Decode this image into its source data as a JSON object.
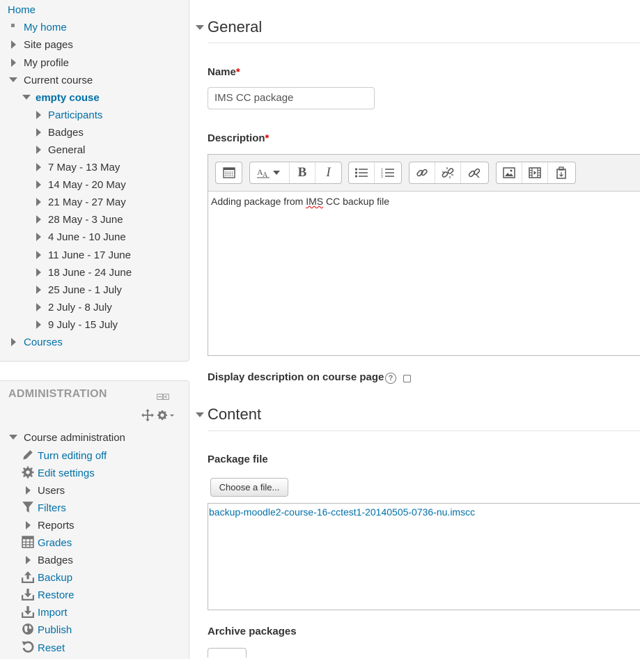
{
  "navigation": {
    "home": "Home",
    "my_home": "My home",
    "site_pages": "Site pages",
    "my_profile": "My profile",
    "current_course": "Current course",
    "course_name": "empty couse",
    "participants": "Participants",
    "badges": "Badges",
    "general": "General",
    "weeks": [
      "7 May - 13 May",
      "14 May - 20 May",
      "21 May - 27 May",
      "28 May - 3 June",
      "4 June - 10 June",
      "11 June - 17 June",
      "18 June - 24 June",
      "25 June - 1 July",
      "2 July - 8 July",
      "9 July - 15 July"
    ],
    "courses": "Courses"
  },
  "administration": {
    "title": "ADMINISTRATION",
    "course_administration": "Course administration",
    "items": [
      {
        "label": "Turn editing off",
        "icon": "pencil-icon",
        "link": true
      },
      {
        "label": "Edit settings",
        "icon": "gear-icon",
        "link": true
      },
      {
        "label": "Users",
        "icon": "expand-arrow-icon",
        "link": false
      },
      {
        "label": "Filters",
        "icon": "filter-icon",
        "link": true
      },
      {
        "label": "Reports",
        "icon": "expand-arrow-icon",
        "link": false
      },
      {
        "label": "Grades",
        "icon": "grades-table-icon",
        "link": true
      },
      {
        "label": "Badges",
        "icon": "expand-arrow-icon",
        "link": false
      },
      {
        "label": "Backup",
        "icon": "upload-icon",
        "link": true
      },
      {
        "label": "Restore",
        "icon": "download-icon",
        "link": true
      },
      {
        "label": "Import",
        "icon": "download-icon",
        "link": true
      },
      {
        "label": "Publish",
        "icon": "globe-icon",
        "link": true
      },
      {
        "label": "Reset",
        "icon": "reset-icon",
        "link": true
      }
    ]
  },
  "form": {
    "general_header": "General",
    "name_label": "Name",
    "required_mark": "*",
    "name_value": "IMS CC package",
    "description_label": "Description",
    "description_prefix": "Adding package from ",
    "description_flagged": "IMS",
    "description_suffix": " CC backup file",
    "display_description_label": "Display description on course page",
    "help_symbol": "?",
    "content_header": "Content",
    "package_file_label": "Package file",
    "choose_file_button": "Choose a file...",
    "file_name": "backup-moodle2-course-16-cctest1-20140505-0736-nu.imscc",
    "archive_packages_label": "Archive packages"
  },
  "editor_toolbar": {
    "bold": "B",
    "italic": "I"
  },
  "colors": {
    "link": "#0070a8",
    "block_bg": "#f5f5f5",
    "required": "#dd0000"
  }
}
